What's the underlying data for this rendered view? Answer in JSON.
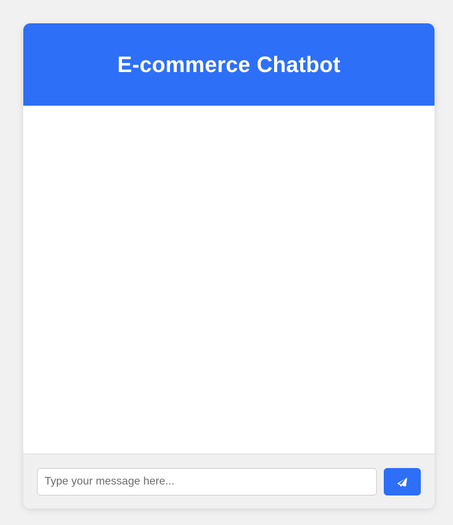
{
  "header": {
    "title": "E-commerce Chatbot"
  },
  "messages": [],
  "composer": {
    "placeholder": "Type your message here...",
    "value": "",
    "send_icon": "paper-plane-icon"
  },
  "colors": {
    "accent": "#2d6ff7",
    "background": "#f1f1f1",
    "card": "#ffffff",
    "input_bar": "#f0f0f0"
  }
}
